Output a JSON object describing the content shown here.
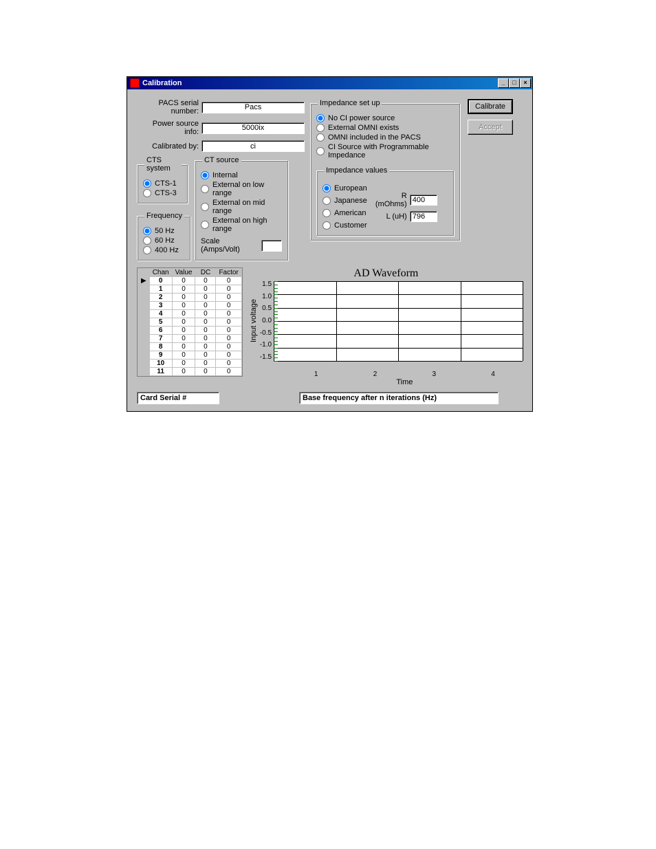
{
  "window_title": "Calibration",
  "fields": {
    "pacs_serial_label": "PACS serial number:",
    "pacs_serial_value": "Pacs",
    "power_source_label": "Power source info:",
    "power_source_value": "5000ix",
    "calibrated_by_label": "Calibrated by:",
    "calibrated_by_value": "ci"
  },
  "cts_system": {
    "legend": "CTS system",
    "options": [
      "CTS-1",
      "CTS-3"
    ],
    "selected": "CTS-1"
  },
  "frequency": {
    "legend": "Frequency",
    "options": [
      "50 Hz",
      "60 Hz",
      "400 Hz"
    ],
    "selected": "50 Hz"
  },
  "ct_source": {
    "legend": "CT source",
    "options": [
      "Internal",
      "External on low range",
      "External on mid range",
      "External on high range"
    ],
    "selected": "Internal",
    "scale_label": "Scale (Amps/Volt)",
    "scale_value": ""
  },
  "impedance": {
    "legend": "Impedance set up",
    "options": [
      "No CI power source",
      "External OMNI exists",
      "OMNI included in the PACS",
      "CI Source with Programmable Impedance"
    ],
    "selected": "No CI power source",
    "values_legend": "Impedance values",
    "standards": [
      "European",
      "Japanese",
      "American",
      "Customer"
    ],
    "standards_selected": "European",
    "r_label": "R (mOhms)",
    "r_value": "400",
    "l_label": "L (uH)",
    "l_value": "796"
  },
  "buttons": {
    "calibrate": "Calibrate",
    "accept": "Accept"
  },
  "table": {
    "headers": [
      "Chan",
      "Value",
      "DC",
      "Factor"
    ],
    "rows": [
      [
        "0",
        "0",
        "0",
        "0"
      ],
      [
        "1",
        "0",
        "0",
        "0"
      ],
      [
        "2",
        "0",
        "0",
        "0"
      ],
      [
        "3",
        "0",
        "0",
        "0"
      ],
      [
        "4",
        "0",
        "0",
        "0"
      ],
      [
        "5",
        "0",
        "0",
        "0"
      ],
      [
        "6",
        "0",
        "0",
        "0"
      ],
      [
        "7",
        "0",
        "0",
        "0"
      ],
      [
        "8",
        "0",
        "0",
        "0"
      ],
      [
        "9",
        "0",
        "0",
        "0"
      ],
      [
        "10",
        "0",
        "0",
        "0"
      ],
      [
        "11",
        "0",
        "0",
        "0"
      ]
    ]
  },
  "chart_data": {
    "type": "line",
    "title": "AD Waveform",
    "xlabel": "Time",
    "ylabel": "Input voltage",
    "x_ticks": [
      "1",
      "2",
      "3",
      "4"
    ],
    "y_ticks": [
      "1.5",
      "1.0",
      "0.5",
      "0.0",
      "-0.5",
      "-1.0",
      "-1.5"
    ],
    "ylim": [
      -1.5,
      1.5
    ],
    "xlim": [
      0,
      5
    ],
    "series": []
  },
  "bottom": {
    "card_serial_label": "Card Serial #",
    "card_serial_value": "",
    "base_freq_label": "Base frequency after n iterations (Hz)",
    "base_freq_value": ""
  }
}
